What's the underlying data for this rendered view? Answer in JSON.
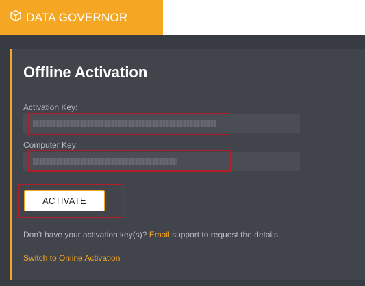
{
  "app": {
    "title": "DATA GOVERNOR",
    "brand_color": "#f5a623",
    "logo_icon": "cube-icon"
  },
  "form": {
    "heading": "Offline Activation",
    "activation_key_label": "Activation Key:",
    "activation_key_value": "",
    "computer_key_label": "Computer Key:",
    "computer_key_value": "",
    "activate_button": "ACTIVATE",
    "help_prefix": "Don't have your activation key(s)? ",
    "help_link": "Email",
    "help_suffix": " support to request the details.",
    "switch_link": "Switch to Online Activation"
  },
  "annotation": {
    "highlight_color": "#b01e2a"
  }
}
